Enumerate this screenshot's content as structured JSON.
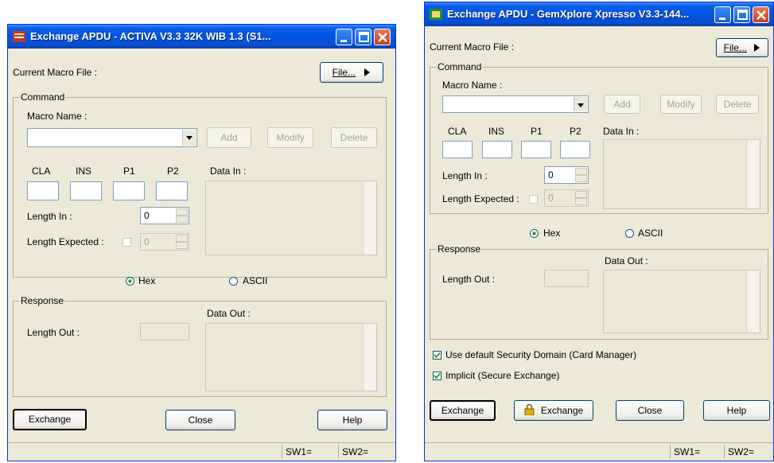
{
  "left_window": {
    "title": "Exchange APDU - ACTIVA V3.3 32K WIB 1.3 (S1...",
    "macro_file_label": "Current Macro File :",
    "file_button": "File...",
    "command_legend": "Command",
    "macro_name_label": "Macro Name :",
    "macro_name_value": "",
    "add_button": "Add",
    "modify_button": "Modify",
    "delete_button": "Delete",
    "cla_label": "CLA",
    "ins_label": "INS",
    "p1_label": "P1",
    "p2_label": "P2",
    "data_in_label": "Data In :",
    "length_in_label": "Length In :",
    "length_in_value": "0",
    "length_expected_label": "Length Expected :",
    "length_expected_value": "0",
    "hex_label": "Hex",
    "ascii_label": "ASCII",
    "format_selected": "Hex",
    "response_legend": "Response",
    "length_out_label": "Length Out :",
    "data_out_label": "Data Out :",
    "exchange_button": "Exchange",
    "close_button": "Close",
    "help_button": "Help",
    "sw1": "SW1=",
    "sw2": "SW2="
  },
  "right_window": {
    "title": "Exchange APDU - GemXplore Xpresso V3.3-144...",
    "macro_file_label": "Current Macro File :",
    "file_button": "File...",
    "command_legend": "Command",
    "macro_name_label": "Macro Name :",
    "macro_name_value": "",
    "add_button": "Add",
    "modify_button": "Modify",
    "delete_button": "Delete",
    "cla_label": "CLA",
    "ins_label": "INS",
    "p1_label": "P1",
    "p2_label": "P2",
    "data_in_label": "Data In :",
    "length_in_label": "Length In :",
    "length_in_value": "0",
    "length_expected_label": "Length Expected :",
    "length_expected_value": "0",
    "hex_label": "Hex",
    "ascii_label": "ASCII",
    "format_selected": "Hex",
    "response_legend": "Response",
    "length_out_label": "Length Out :",
    "data_out_label": "Data Out :",
    "security_domain_label": "Use default Security Domain (Card Manager)",
    "security_domain_checked": true,
    "implicit_label": "Implicit (Secure Exchange)",
    "implicit_checked": true,
    "exchange_button": "Exchange",
    "secure_exchange_button": "Exchange",
    "close_button": "Close",
    "help_button": "Help",
    "sw1": "SW1=",
    "sw2": "SW2="
  },
  "icons": {
    "title_left": "app-icon-activa",
    "title_right": "app-icon-gemxplore",
    "file_arrow": "triangle-right-icon",
    "combo": "chevron-down-icon",
    "lock": "lock-icon"
  },
  "colors": {
    "title_bar": "#0054e3",
    "window_face": "#ece9d8",
    "close_button": "#c8401c"
  }
}
